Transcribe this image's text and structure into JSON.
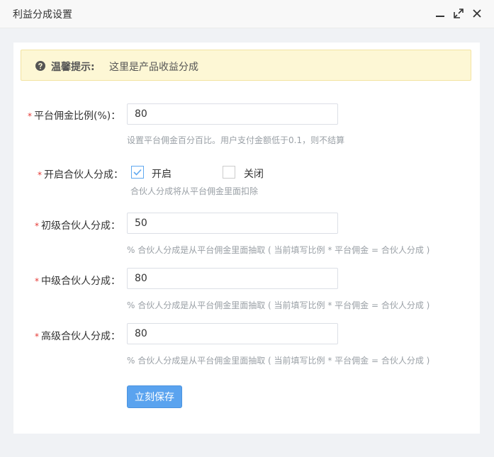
{
  "window": {
    "title": "利益分成设置"
  },
  "tip": {
    "strong": "温馨提示:",
    "text": "这里是产品收益分成"
  },
  "form": {
    "platform": {
      "required_mark": "*",
      "label": "平台佣金比例(%)：",
      "value": "80",
      "hint": "设置平台佣金百分百比。用户支付金额低于0.1，则不结算"
    },
    "partner_toggle": {
      "required_mark": "*",
      "label": "开启合伙人分成：",
      "on_label": "开启",
      "off_label": "关闭",
      "selected": "开启",
      "hint": "合伙人分成将从平台佣金里面扣除"
    },
    "junior": {
      "required_mark": "*",
      "label": "初级合伙人分成：",
      "value": "50",
      "hint": "% 合伙人分成是从平台佣金里面抽取 ( 当前填写比例 * 平台佣金 = 合伙人分成 )"
    },
    "middle": {
      "required_mark": "*",
      "label": "中级合伙人分成：",
      "value": "80",
      "hint": "% 合伙人分成是从平台佣金里面抽取 ( 当前填写比例 * 平台佣金 = 合伙人分成 )"
    },
    "senior": {
      "required_mark": "*",
      "label": "高级合伙人分成：",
      "value": "80",
      "hint": "% 合伙人分成是从平台佣金里面抽取 ( 当前填写比例 * 平台佣金 = 合伙人分成 )"
    },
    "save_label": "立刻保存"
  },
  "colors": {
    "accent": "#5aa3ef",
    "required": "#e53935",
    "tip_bg": "#fdf7d5"
  },
  "icons": {
    "minimize": "minimize-icon",
    "maximize": "maximize-icon",
    "close": "close-icon",
    "tip": "question-circle-icon",
    "check": "check-icon"
  }
}
